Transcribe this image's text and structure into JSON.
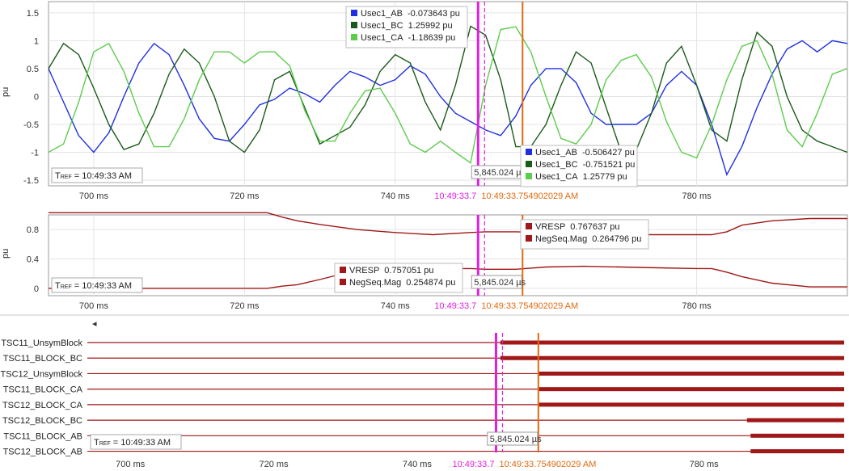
{
  "tref_label": "10:49:33 AM",
  "x_ticks": [
    {
      "label": "700 ms",
      "value": 700
    },
    {
      "label": "720 ms",
      "value": 720
    },
    {
      "label": "740 ms",
      "value": 740
    },
    {
      "label": "780 ms",
      "value": 780
    }
  ],
  "cursor_magenta": {
    "time_ms": 751.0,
    "label": "10:49:33.7",
    "color": "#e020e0"
  },
  "cursor_orange": {
    "time_ms": 756.9,
    "label": "10:49:33.754902029 AM",
    "color": "#e06a10"
  },
  "delta_label": "5,845.024 µs",
  "scroll_arrow": "◂",
  "colors": {
    "ab": "#2030e0",
    "bc": "#1a5a1a",
    "ca": "#5ccc4c",
    "red": "#a01818",
    "grid": "#e4e4e4"
  },
  "chart_data": [
    {
      "type": "line",
      "ylabel": "pu",
      "ylim": [
        -1.6,
        1.7
      ],
      "yticks": [
        {
          "v": 1.5,
          "t": "1.5"
        },
        {
          "v": 1,
          "t": "1"
        },
        {
          "v": 0.5,
          "t": "0.5"
        },
        {
          "v": 0,
          "t": "0"
        },
        {
          "v": -0.5,
          "t": "-0.5"
        },
        {
          "v": -1,
          "t": "-1"
        },
        {
          "v": -1.5,
          "t": "-1.5"
        }
      ],
      "xlim": [
        694,
        800
      ],
      "series": [
        {
          "name": "Usec1_AB",
          "key": "ab",
          "x": [
            694,
            696,
            698,
            700,
            702,
            704,
            706,
            708,
            710,
            712,
            714,
            716,
            718,
            720,
            722,
            724,
            726,
            728,
            730,
            732,
            734,
            736,
            738,
            740,
            742,
            744,
            746,
            748,
            750,
            752,
            754,
            756,
            758,
            760,
            762,
            764,
            766,
            768,
            770,
            772,
            774,
            776,
            778,
            780,
            782,
            784,
            786,
            788,
            790,
            792,
            794,
            796,
            798,
            800
          ],
          "values": [
            0.5,
            -0.1,
            -0.7,
            -1.0,
            -0.65,
            0.0,
            0.6,
            0.95,
            0.75,
            0.2,
            -0.4,
            -0.75,
            -0.8,
            -0.5,
            -0.15,
            -0.05,
            0.15,
            0.05,
            -0.1,
            0.2,
            0.45,
            0.35,
            0.2,
            0.3,
            0.55,
            0.4,
            0.0,
            -0.3,
            -0.45,
            -0.6,
            -0.7,
            -0.35,
            0.2,
            0.5,
            0.5,
            0.25,
            -0.3,
            -0.5,
            -0.5,
            -0.5,
            -0.3,
            0.2,
            0.45,
            0.2,
            -0.5,
            -1.4,
            -0.9,
            -0.2,
            0.4,
            0.85,
            1.0,
            0.8,
            1.0,
            0.95
          ]
        },
        {
          "name": "Usec1_BC",
          "key": "bc",
          "x": [
            694,
            696,
            698,
            700,
            702,
            704,
            706,
            708,
            710,
            712,
            714,
            716,
            718,
            720,
            722,
            724,
            726,
            728,
            730,
            732,
            734,
            736,
            738,
            740,
            742,
            744,
            746,
            748,
            750,
            752,
            754,
            756,
            758,
            760,
            762,
            764,
            766,
            768,
            770,
            772,
            774,
            776,
            778,
            780,
            782,
            784,
            786,
            788,
            790,
            792,
            794,
            796,
            798,
            800
          ],
          "values": [
            0.5,
            0.95,
            0.75,
            0.15,
            -0.5,
            -0.95,
            -0.85,
            -0.3,
            0.4,
            0.85,
            0.6,
            0.0,
            -0.8,
            -1.0,
            -0.6,
            0.3,
            0.45,
            -0.2,
            -0.85,
            -0.7,
            -0.55,
            -0.15,
            0.45,
            0.75,
            0.6,
            -0.1,
            -0.6,
            0.2,
            1.26,
            1.1,
            0.3,
            -0.9,
            -0.9,
            -0.5,
            0.2,
            0.8,
            0.6,
            -0.2,
            -1.0,
            -0.95,
            -0.3,
            0.6,
            0.9,
            0.2,
            -0.6,
            -0.8,
            0.3,
            1.15,
            0.9,
            0.0,
            -0.6,
            -0.8,
            -0.9,
            -1.0
          ]
        },
        {
          "name": "Usec1_CA",
          "key": "ca",
          "x": [
            694,
            696,
            698,
            700,
            702,
            704,
            706,
            708,
            710,
            712,
            714,
            716,
            718,
            720,
            722,
            724,
            726,
            728,
            730,
            732,
            734,
            736,
            738,
            740,
            742,
            744,
            746,
            748,
            750,
            752,
            754,
            756,
            758,
            760,
            762,
            764,
            766,
            768,
            770,
            772,
            774,
            776,
            778,
            780,
            782,
            784,
            786,
            788,
            790,
            792,
            794,
            796,
            798,
            800
          ],
          "values": [
            -1.0,
            -0.85,
            -0.1,
            0.8,
            0.95,
            0.45,
            -0.3,
            -0.9,
            -0.9,
            -0.4,
            0.3,
            0.8,
            0.8,
            0.6,
            0.8,
            0.8,
            0.55,
            -0.25,
            -0.8,
            -0.8,
            -0.3,
            0.1,
            0.15,
            -0.3,
            -0.85,
            -1.0,
            -0.8,
            -1.0,
            -1.19,
            0.2,
            1.2,
            1.25,
            0.8,
            0.0,
            -0.75,
            -0.85,
            -0.5,
            0.3,
            0.65,
            0.75,
            0.35,
            -0.45,
            -1.0,
            -1.1,
            -0.5,
            0.3,
            0.9,
            1.0,
            0.4,
            -0.6,
            -0.9,
            -0.3,
            0.4,
            0.5
          ]
        }
      ],
      "legend_left": [
        {
          "name": "Usec1_AB",
          "key": "ab",
          "value": "-0.073643 pu"
        },
        {
          "name": "Usec1_BC",
          "key": "bc",
          "value": "1.25992 pu"
        },
        {
          "name": "Usec1_CA",
          "key": "ca",
          "value": "-1.18639 pu"
        }
      ],
      "legend_right": [
        {
          "name": "Usec1_AB",
          "key": "ab",
          "value": "-0.506427 pu"
        },
        {
          "name": "Usec1_BC",
          "key": "bc",
          "value": "-0.751521 pu"
        },
        {
          "name": "Usec1_CA",
          "key": "ca",
          "value": "1.25779 pu"
        }
      ]
    },
    {
      "type": "line",
      "ylabel": "pu",
      "ylim": [
        -0.1,
        1.0
      ],
      "yticks": [
        {
          "v": 0.8,
          "t": "0.8"
        },
        {
          "v": 0.4,
          "t": "0.4"
        },
        {
          "v": 0,
          "t": "0"
        }
      ],
      "xlim": [
        694,
        800
      ],
      "series": [
        {
          "name": "VRESP",
          "key": "red",
          "x": [
            694,
            700,
            710,
            720,
            723,
            725,
            727,
            730,
            735,
            740,
            745,
            750,
            752,
            756,
            760,
            765,
            770,
            775,
            780,
            782,
            784,
            786,
            790,
            795,
            800
          ],
          "values": [
            1.03,
            1.03,
            1.03,
            1.03,
            1.03,
            0.97,
            0.92,
            0.87,
            0.8,
            0.76,
            0.73,
            0.76,
            0.77,
            0.77,
            0.76,
            0.74,
            0.73,
            0.73,
            0.73,
            0.73,
            0.77,
            0.86,
            0.92,
            0.95,
            0.95
          ]
        },
        {
          "name": "NegSeq.Mag",
          "key": "red",
          "x": [
            694,
            700,
            710,
            720,
            723,
            725,
            727,
            730,
            735,
            740,
            745,
            750,
            752,
            756,
            760,
            765,
            770,
            775,
            780,
            782,
            784,
            786,
            790,
            795,
            800
          ],
          "values": [
            0.0,
            0.0,
            0.0,
            0.0,
            0.0,
            0.03,
            0.05,
            0.12,
            0.25,
            0.26,
            0.27,
            0.27,
            0.26,
            0.26,
            0.29,
            0.3,
            0.29,
            0.28,
            0.27,
            0.27,
            0.22,
            0.16,
            0.07,
            0.02,
            0.02
          ]
        }
      ],
      "legend_left": [
        {
          "name": "VRESP",
          "key": "red",
          "value": "0.757051 pu"
        },
        {
          "name": "NegSeq.Mag",
          "key": "red",
          "value": "0.254874 pu"
        }
      ],
      "legend_right": [
        {
          "name": "VRESP",
          "key": "red",
          "value": "0.767637 pu"
        },
        {
          "name": "NegSeq.Mag",
          "key": "red",
          "value": "0.264796 pu"
        }
      ]
    },
    {
      "type": "digital",
      "xlim": [
        694,
        800
      ],
      "channels": [
        {
          "name": "TSC11_UnsymBlock",
          "on_from_ms": 751.6
        },
        {
          "name": "TSC11_BLOCK_BC",
          "on_from_ms": 751.6
        },
        {
          "name": "TSC12_UnsymBlock",
          "on_from_ms": 757.0
        },
        {
          "name": "TSC11_BLOCK_CA",
          "on_from_ms": 757.0
        },
        {
          "name": "TSC12_BLOCK_CA",
          "on_from_ms": 757.0
        },
        {
          "name": "TSC12_BLOCK_BC",
          "on_from_ms": 786.0
        },
        {
          "name": "TSC11_BLOCK_AB",
          "on_from_ms": 786.5
        },
        {
          "name": "TSC12_BLOCK_AB",
          "on_from_ms": 786.5
        }
      ]
    }
  ]
}
